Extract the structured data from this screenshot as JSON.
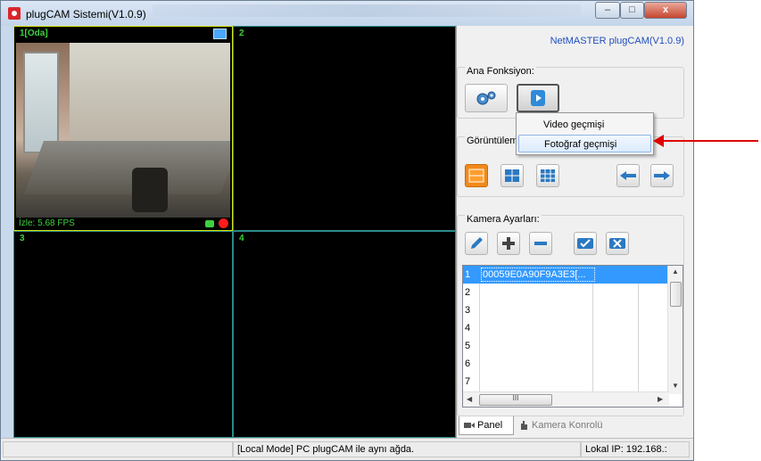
{
  "window": {
    "title": "plugCAM Sistemi(V1.0.9)"
  },
  "titlebar": {
    "minimize": "–",
    "maximize": "□",
    "close": "x"
  },
  "cameras": [
    {
      "label": "1[Oda]",
      "fps": "İzle: 5.68 FPS"
    },
    {
      "label": "2"
    },
    {
      "label": "3"
    },
    {
      "label": "4"
    }
  ],
  "panel": {
    "brand": "NetMASTER plugCAM(V1.0.9)",
    "main_function_label": "Ana Fonksiyon:",
    "view_label": "Görüntüleme:",
    "camera_settings_label": "Kamera Ayarları:"
  },
  "menu": {
    "items": [
      "Video geçmişi",
      "Fotoğraf geçmişi"
    ]
  },
  "camera_list": {
    "rows": [
      {
        "num": "1",
        "id": "00059E0A90F9A3E3[..."
      },
      {
        "num": "2",
        "id": ""
      },
      {
        "num": "3",
        "id": ""
      },
      {
        "num": "4",
        "id": ""
      },
      {
        "num": "5",
        "id": ""
      },
      {
        "num": "6",
        "id": ""
      },
      {
        "num": "7",
        "id": ""
      }
    ],
    "scroll_thumb": "III"
  },
  "tabs": {
    "panel": "Panel",
    "camera_control": "Kamera Konrolü"
  },
  "status": {
    "mode": "[Local Mode] PC plugCAM ile aynı ağda.",
    "ip": "Lokal IP: 192.168.:"
  },
  "colors": {
    "overlay_green": "#3ed13e",
    "record_red": "#ff1b1b",
    "active_border": "#d8e600",
    "annotation_arrow": "#e00000"
  }
}
